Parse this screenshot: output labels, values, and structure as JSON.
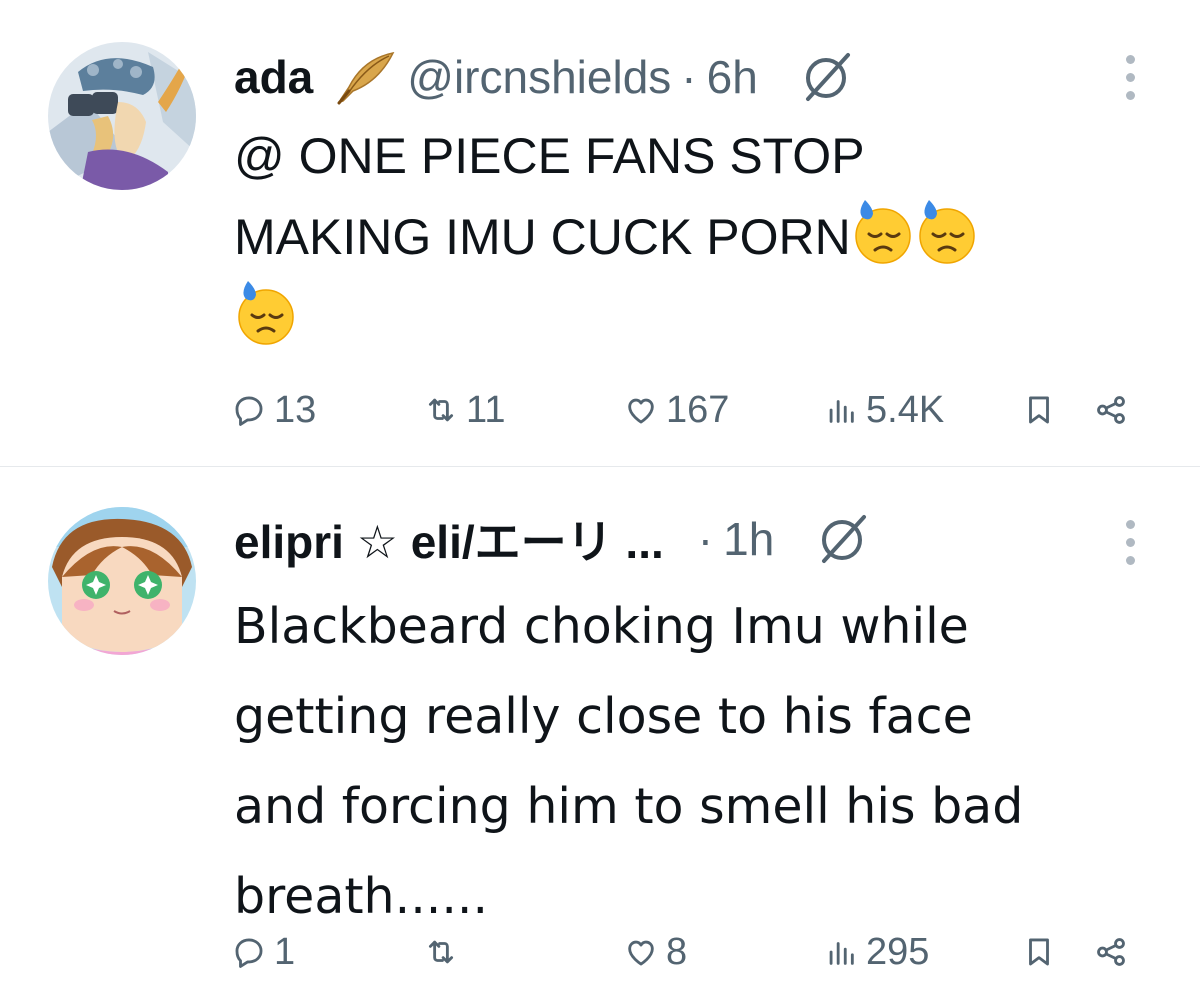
{
  "tweets": [
    {
      "display_name": "ada",
      "name_emoji": "feather",
      "handle": "@ircnshields",
      "separator": "·",
      "time": "6h",
      "text_lines": [
        "@ ONE PIECE FANS STOP",
        "MAKING IMU CUCK PORN"
      ],
      "text_emojis": [
        "downcast-sweat-face",
        "downcast-sweat-face",
        "downcast-sweat-face"
      ],
      "stats": {
        "replies": "13",
        "reposts": "11",
        "likes": "167",
        "views": "5.4K"
      }
    },
    {
      "display_name": "elipri ☆ eli/エーリ ...",
      "separator": "·",
      "time": "1h",
      "text_lines": [
        "Blackbeard choking Imu while",
        "getting really close to his face",
        "and forcing him to smell his bad",
        "breath......"
      ],
      "stats": {
        "replies": "1",
        "reposts": "",
        "likes": "8",
        "views": "295"
      }
    }
  ],
  "colors": {
    "text": "#0f1419",
    "secondary": "#536471",
    "divider": "#e6e9ec"
  },
  "icons": [
    "reply-icon",
    "repost-icon",
    "like-icon",
    "views-icon",
    "bookmark-icon",
    "share-icon",
    "grok-icon",
    "more-icon"
  ]
}
